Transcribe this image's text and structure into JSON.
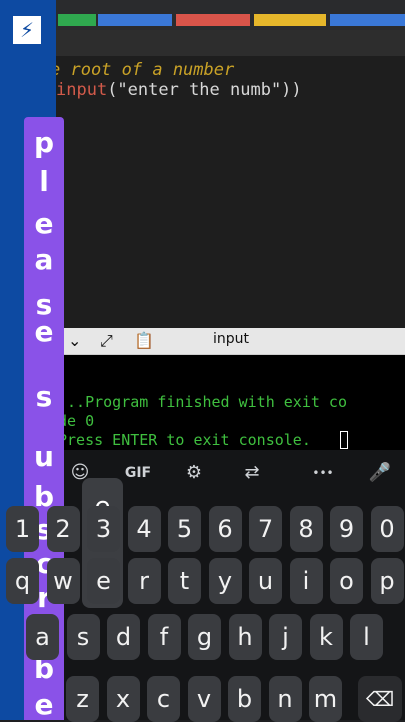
{
  "editor": {
    "line1": "e root of a number",
    "line2_kw": "input",
    "line2_rest": "(\"enter the numb\"))"
  },
  "console": {
    "label": "input",
    "line1": "...Program finished with exit co",
    "line2": "de 0",
    "line3": "Press ENTER to exit console."
  },
  "banner": {
    "letters": [
      "p",
      "l",
      "e",
      "a",
      "s",
      "e",
      "s",
      "u",
      "b",
      "s",
      "c",
      "r",
      "i",
      "b",
      "e"
    ]
  },
  "keyboard": {
    "toolbar": {
      "gif": "GIF",
      "more": "•••"
    },
    "popup": {
      "letter": "e",
      "dots": "..."
    },
    "row1": [
      "1",
      "2",
      "3",
      "4",
      "5",
      "6",
      "7",
      "8",
      "9",
      "0"
    ],
    "row2": [
      "q",
      "w",
      "e",
      "r",
      "t",
      "y",
      "u",
      "i",
      "o",
      "p"
    ],
    "row3": [
      "a",
      "s",
      "d",
      "f",
      "g",
      "h",
      "j",
      "k",
      "l"
    ],
    "row4": [
      "z",
      "x",
      "c",
      "v",
      "b",
      "n",
      "m"
    ]
  },
  "colors": {
    "blue_panel": "#0d4aa2",
    "purple_banner": "#8a52e8",
    "console_green": "#3fbf3f"
  }
}
